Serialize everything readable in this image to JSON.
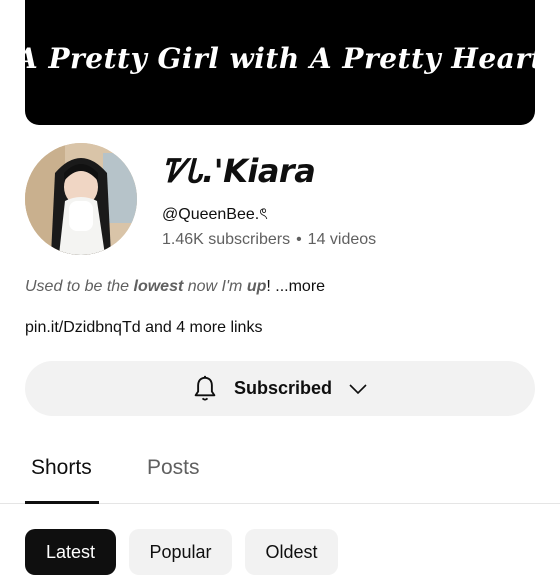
{
  "banner": {
    "text": "A Pretty Girl with A Pretty Heart"
  },
  "channel": {
    "name": "ᏤᏓ.'Kiara",
    "handle": "@QueenBee.ৎ",
    "subscribers": "1.46K subscribers",
    "separator": "•",
    "videos": "14 videos"
  },
  "description": {
    "part1": "Used to be the ",
    "bold1": "lowest",
    "part2": " now I'm ",
    "bold2": "up",
    "part3": "! ",
    "more": "...more"
  },
  "links": {
    "text": "pin.it/DzidbnqTd and 4 more links"
  },
  "subscribe_button": {
    "label": "Subscribed",
    "icon": "bell-icon",
    "chevron": "chevron-down-icon"
  },
  "tabs": [
    {
      "label": "Shorts",
      "active": true
    },
    {
      "label": "Posts",
      "active": false
    }
  ],
  "chips": [
    {
      "label": "Latest",
      "selected": true
    },
    {
      "label": "Popular",
      "selected": false
    },
    {
      "label": "Oldest",
      "selected": false
    }
  ],
  "colors": {
    "text": "#0f0f0f",
    "secondary": "#606060",
    "chip_bg": "#f2f2f2",
    "banner_bg": "#000000"
  }
}
